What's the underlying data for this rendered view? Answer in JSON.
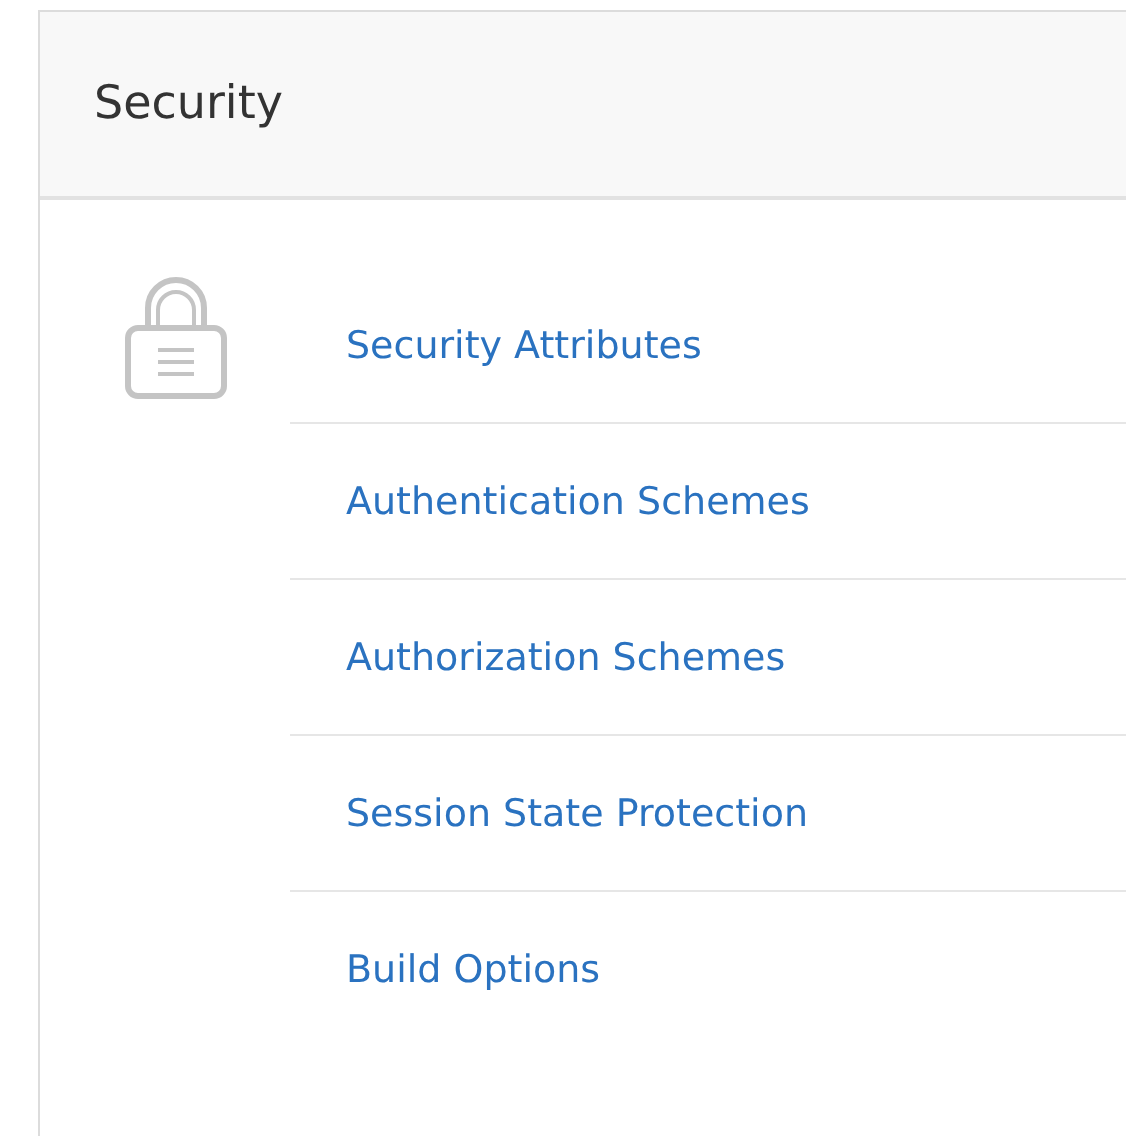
{
  "panel": {
    "title": "Security"
  },
  "links": [
    {
      "label": "Security Attributes"
    },
    {
      "label": "Authentication Schemes"
    },
    {
      "label": "Authorization Schemes"
    },
    {
      "label": "Session State Protection"
    },
    {
      "label": "Build Options"
    }
  ]
}
